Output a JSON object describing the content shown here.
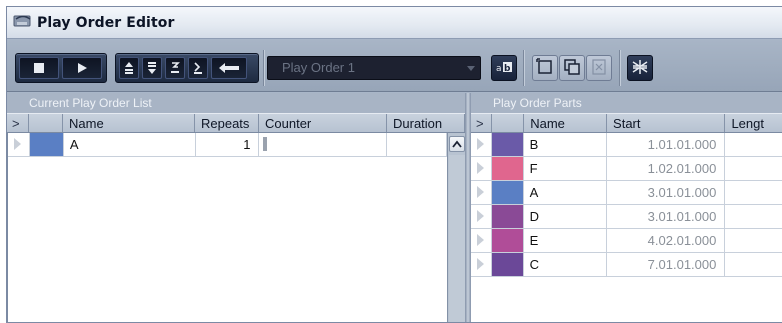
{
  "window": {
    "title": "Play Order Editor"
  },
  "toolbar": {
    "dropdown_value": "Play Order 1",
    "transport_icons": [
      "stop-icon",
      "play-icon"
    ],
    "nav_icons": [
      "move-to-top-icon",
      "move-to-bottom-icon",
      "move-left-icon",
      "move-right-icon",
      "return-icon"
    ],
    "edit_icons": [
      "rename-icon",
      "new-play-order-icon",
      "duplicate-play-order-icon",
      "delete-play-order-icon",
      "flatten-icon"
    ]
  },
  "left_pane": {
    "title": "Current Play Order List",
    "columns": [
      ">",
      "",
      "Name",
      "Repeats",
      "Counter",
      "Duration"
    ],
    "rows": [
      {
        "color": "#5a7fc4",
        "name": "A",
        "repeats": "1",
        "counter": "",
        "duration": ""
      }
    ]
  },
  "right_pane": {
    "title": "Play Order Parts",
    "columns": [
      ">",
      "",
      "Name",
      "Start",
      "Lengt"
    ],
    "rows": [
      {
        "color": "#6a5aa8",
        "name": "B",
        "start": "1.01.01.000"
      },
      {
        "color": "#e0668e",
        "name": "F",
        "start": "1.02.01.000"
      },
      {
        "color": "#5a7fc4",
        "name": "A",
        "start": "3.01.01.000"
      },
      {
        "color": "#8a4a96",
        "name": "D",
        "start": "3.01.01.000"
      },
      {
        "color": "#b04d98",
        "name": "E",
        "start": "4.02.01.000"
      },
      {
        "color": "#6b4898",
        "name": "C",
        "start": "7.01.01.000"
      }
    ]
  }
}
